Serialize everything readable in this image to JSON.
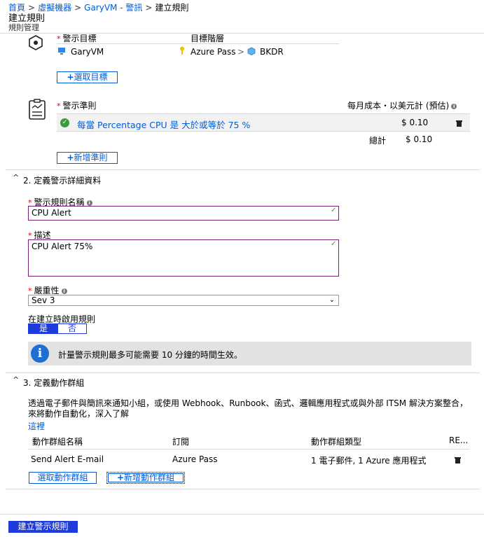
{
  "breadcrumb": [
    "首頁",
    "虛擬機器",
    "GaryVM - 警訊",
    "建立規則"
  ],
  "header": {
    "title": "建立規則",
    "subtitle": "規則管理"
  },
  "target": {
    "label": "警示目標",
    "hierarchy_label": "目標階層",
    "resource": "GaryVM",
    "subscription": "Azure Pass",
    "resource_group": "BKDR",
    "select_button": "選取目標"
  },
  "criteria": {
    "label": "警示準則",
    "cost_label": "每月成本・以美元計 (預估)",
    "condition": "每當 Percentage CPU 是 大於或等於 75 %",
    "condition_cost": "$ 0.10",
    "total_label": "總計",
    "total": "$ 0.10",
    "add_button": "新增準則"
  },
  "details": {
    "section_title": "2. 定義警示詳細資料",
    "name_label": "警示規則名稱",
    "name_value": "CPU  Alert",
    "desc_label": "描述",
    "desc_value": "CPU  Alert 75%",
    "severity_label": "嚴重性",
    "severity_value": "Sev 3",
    "enable_label": "在建立時啟用規則",
    "toggle_yes": "是",
    "toggle_no": "否",
    "info_text": "計量警示規則最多可能需要 10 分鐘的時間生效。"
  },
  "actions": {
    "section_title": "3. 定義動作群組",
    "description": "透過電子郵件與簡訊來通知小組，或使用 Webhook、Runbook、函式、邏輯應用程式或與外部 ITSM 解決方案整合，來將動作自動化，深入了解",
    "link": "這裡",
    "columns": [
      "動作群組名稱",
      "訂閱",
      "動作群組類型",
      "RE..."
    ],
    "rows": [
      {
        "name": "Send Alert E-mail",
        "subscription": "Azure Pass",
        "type": "1 電子郵件, 1 Azure 應用程式"
      }
    ],
    "select_button": "選取動作群組",
    "new_button": "新增動作群組"
  },
  "footer": {
    "create_button": "建立警示規則"
  },
  "colors": {
    "accent": "#015cda",
    "primary_button": "#1f3bdb",
    "invalid_border": "#7a1f7a",
    "success": "#3a9b3a"
  }
}
